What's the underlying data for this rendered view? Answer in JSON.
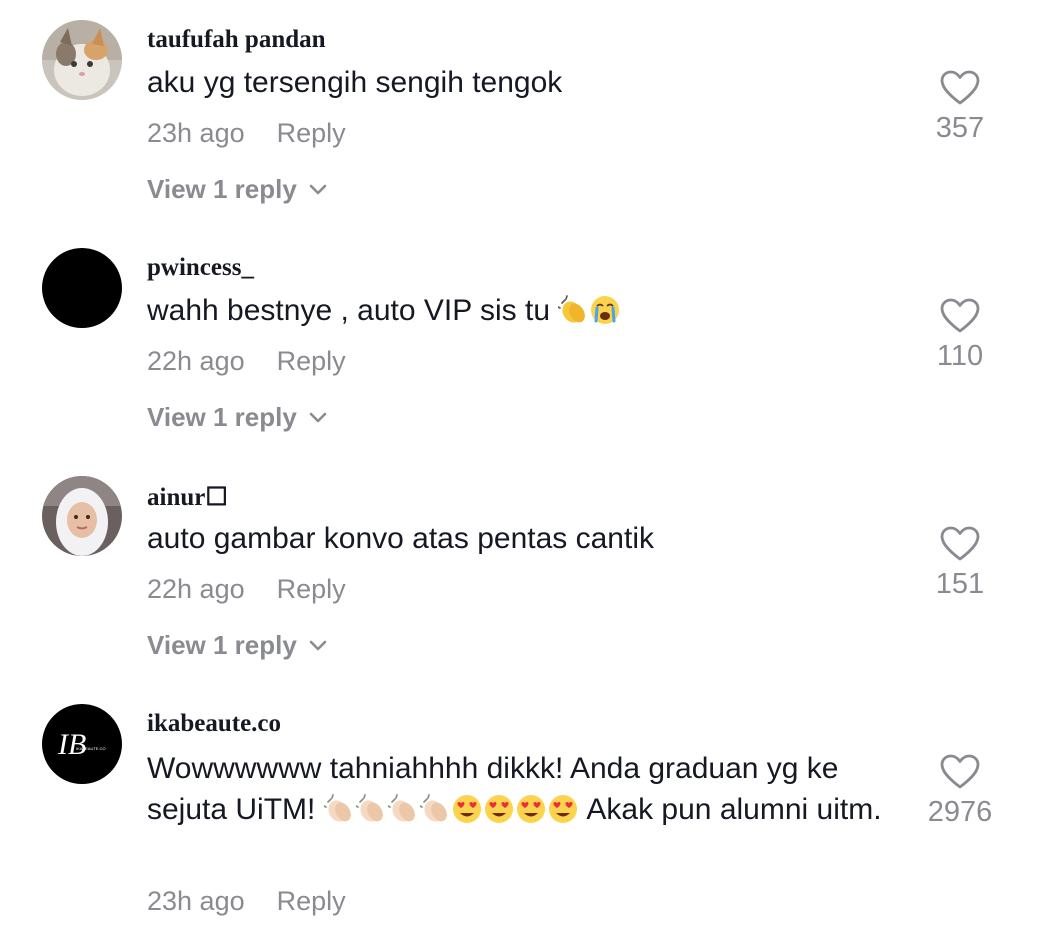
{
  "comments": [
    {
      "username": "taufufah pandan",
      "text": "aku yg tersengih sengih tengok",
      "time": "23h ago",
      "reply_label": "Reply",
      "view_replies": "View 1 reply",
      "likes": "357",
      "avatar": "cat-photo"
    },
    {
      "username": "pwincess_",
      "text": "wahh bestnye , auto VIP sis tu",
      "emojis": [
        "clapping-hands-emoji",
        "crying-face-emoji"
      ],
      "time": "22h ago",
      "reply_label": "Reply",
      "view_replies": "View 1 reply",
      "likes": "110",
      "avatar": "black-circle"
    },
    {
      "username": "ainur☐",
      "text": "auto gambar konvo atas pentas cantik",
      "time": "22h ago",
      "reply_label": "Reply",
      "view_replies": "View 1 reply",
      "likes": "151",
      "avatar": "hijab-portrait"
    },
    {
      "username": "ikabeaute.co",
      "text_part1": "Wowwwwww tahniahhhh dikkk! Anda graduan yg ke sejuta UiTM!",
      "text_part2": "Akak pun alumni uitm.",
      "emojis": [
        "clapping-hands-emoji",
        "clapping-hands-emoji",
        "clapping-hands-emoji",
        "clapping-hands-emoji",
        "heart-eyes-emoji",
        "heart-eyes-emoji",
        "heart-eyes-emoji",
        "heart-eyes-emoji"
      ],
      "time": "23h ago",
      "reply_label": "Reply",
      "likes": "2976",
      "avatar": "ikabeaute-logo",
      "logo_text": "IKABEAUTE.CO"
    }
  ],
  "colors": {
    "primary_text": "#161823",
    "secondary_text": "#8a8b91",
    "background": "#ffffff"
  }
}
